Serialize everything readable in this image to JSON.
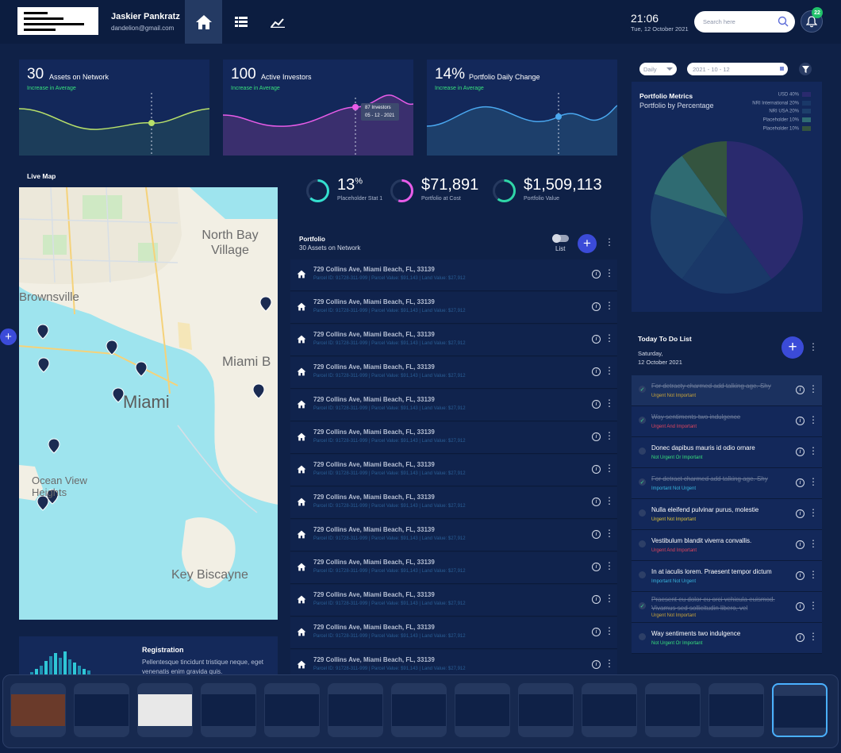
{
  "user": {
    "name": "Jaskier Pankratz",
    "email": "dandelion@gmail.com"
  },
  "nav": [
    {
      "icon": "home-icon"
    },
    {
      "icon": "list-icon"
    },
    {
      "icon": "chart-icon"
    }
  ],
  "clock": {
    "time": "21:06",
    "date": "Tue, 12 October 2021"
  },
  "search": {
    "placeholder": "Search here"
  },
  "notifications": {
    "count": "22"
  },
  "stats": [
    {
      "value": "30",
      "label": "Assets on Network",
      "sub": "Increase in Average",
      "color": "#b8e06a"
    },
    {
      "value": "100",
      "label": "Active Investors",
      "sub": "Increase in Average",
      "color": "#e85ce8",
      "tooltip": {
        "line1": "87 Investors",
        "line2": "05 - 12 - 2021"
      }
    },
    {
      "value": "14%",
      "label": "Portfolio Daily Change",
      "sub": "Increase in Average",
      "color": "#4aa8f0"
    }
  ],
  "livemap": {
    "title": "Live Map",
    "labels": [
      "North Bay Village",
      "Brownsville",
      "Miami B",
      "Miami",
      "Ocean View Heights",
      "Key Biscayne"
    ]
  },
  "summary": [
    {
      "value": "13",
      "sup": "%",
      "label": "Placeholder Stat 1",
      "color": "#34dfcf",
      "fraction": 0.62
    },
    {
      "value": "$71,891",
      "sup": "",
      "label": "Portfolio at Cost",
      "color": "#e85ce8",
      "fraction": 0.55
    },
    {
      "value": "$1,509,113",
      "sup": "",
      "label": "Portfolio Value",
      "color": "#2fd6a7",
      "fraction": 0.6
    }
  ],
  "portfolio": {
    "title": "Portfolio",
    "subtitle": "30 Assets on Network",
    "toggle_label": "List",
    "rows": [
      {
        "address": "729 Collins Ave, Miami Beach, FL, 33139",
        "meta": "Parcel ID: 91728-311-999  |  Parcel Value: $91,143  |  Land Value: $27,912"
      },
      {
        "address": "729 Collins Ave, Miami Beach, FL, 33139",
        "meta": "Parcel ID: 91728-311-999  |  Parcel Value: $91,143  |  Land Value: $27,912"
      },
      {
        "address": "729 Collins Ave, Miami Beach, FL, 33139",
        "meta": "Parcel ID: 91728-311-999  |  Parcel Value: $91,143  |  Land Value: $27,912"
      },
      {
        "address": "729 Collins Ave, Miami Beach, FL, 33139",
        "meta": "Parcel ID: 91728-311-999  |  Parcel Value: $91,143  |  Land Value: $27,912"
      },
      {
        "address": "729 Collins Ave, Miami Beach, FL, 33139",
        "meta": "Parcel ID: 91728-311-999  |  Parcel Value: $91,143  |  Land Value: $27,912"
      },
      {
        "address": "729 Collins Ave, Miami Beach, FL, 33139",
        "meta": "Parcel ID: 91728-311-999  |  Parcel Value: $91,143  |  Land Value: $27,912"
      },
      {
        "address": "729 Collins Ave, Miami Beach, FL, 33139",
        "meta": "Parcel ID: 91728-311-999  |  Parcel Value: $91,143  |  Land Value: $27,912"
      },
      {
        "address": "729 Collins Ave, Miami Beach, FL, 33139",
        "meta": "Parcel ID: 91728-311-999  |  Parcel Value: $91,143  |  Land Value: $27,912"
      },
      {
        "address": "729 Collins Ave, Miami Beach, FL, 33139",
        "meta": "Parcel ID: 91728-311-999  |  Parcel Value: $91,143  |  Land Value: $27,912"
      },
      {
        "address": "729 Collins Ave, Miami Beach, FL, 33139",
        "meta": "Parcel ID: 91728-311-999  |  Parcel Value: $91,143  |  Land Value: $27,912"
      },
      {
        "address": "729 Collins Ave, Miami Beach, FL, 33139",
        "meta": "Parcel ID: 91728-311-999  |  Parcel Value: $91,143  |  Land Value: $27,912"
      },
      {
        "address": "729 Collins Ave, Miami Beach, FL, 33139",
        "meta": "Parcel ID: 91728-311-999  |  Parcel Value: $91,143  |  Land Value: $27,912"
      },
      {
        "address": "729 Collins Ave, Miami Beach, FL, 33139",
        "meta": "Parcel ID: 91728-311-999  |  Parcel Value: $91,143  |  Land Value: $27,912"
      }
    ]
  },
  "registration": {
    "title": "Registration",
    "text": "Pellentesque tincidunt tristique neque, eget venenatis enim gravida quis."
  },
  "filters": {
    "period": "Daily",
    "daterange": "2021 - 10 - 12"
  },
  "portfolio_metrics": {
    "title": "Portfolio Metrics",
    "subtitle": "Portfolio by Percentage",
    "legend": [
      {
        "label": "USD 40%",
        "color": "#2a2a6e"
      },
      {
        "label": "NRI International 20%",
        "color": "#1a3868"
      },
      {
        "label": "NRI USA 20%",
        "color": "#1d3f6b"
      },
      {
        "label": "Placeholder 10%",
        "color": "#2f6b72"
      },
      {
        "label": "Placeholder 10%",
        "color": "#34543f"
      }
    ]
  },
  "chart_data": {
    "type": "pie",
    "title": "Portfolio by Percentage",
    "categories": [
      "USD",
      "NRI International",
      "NRI USA",
      "Placeholder",
      "Placeholder"
    ],
    "values": [
      40,
      20,
      20,
      10,
      10
    ]
  },
  "todo": {
    "title": "Today To Do List",
    "day": "Saturday,",
    "date": "12 October 2021",
    "items": [
      {
        "text": "For detracty charmed add talking age. Shy",
        "priority": "Urgent Not Important",
        "pcolor": "#c9a43a",
        "done": true
      },
      {
        "text": "Way sentiments two indulgence",
        "priority": "Urgent And Important",
        "pcolor": "#e0455f",
        "done": true
      },
      {
        "text": "Donec dapibus mauris id odio ornare",
        "priority": "Not Urgent Or Important",
        "pcolor": "#37e07d",
        "done": false
      },
      {
        "text": "For detract charmed add talking age. Shy",
        "priority": "Important Not Urgent",
        "pcolor": "#37b6e0",
        "done": true
      },
      {
        "text": "Nulla eleifend pulvinar purus, molestie",
        "priority": "Urgent Not Important",
        "pcolor": "#e0c43a",
        "done": false
      },
      {
        "text": "Vestibulum blandit viverra convallis.",
        "priority": "Urgent And Important",
        "pcolor": "#e0455f",
        "done": false
      },
      {
        "text": "In at iaculis lorem. Praesent tempor dictum",
        "priority": "Important Not Urgent",
        "pcolor": "#37b6e0",
        "done": false
      },
      {
        "text": "Praesent eu dolor eu orci vehicula euismod. Vivamus sed sollicitudin libero, vel",
        "priority": "Urgent Not Important",
        "pcolor": "#c9a43a",
        "done": true
      },
      {
        "text": "Way sentiments two indulgence",
        "priority": "Not Urgent Or Important",
        "pcolor": "#37e07d",
        "done": false
      }
    ]
  },
  "dock": {
    "count": 13,
    "selected": 12
  }
}
